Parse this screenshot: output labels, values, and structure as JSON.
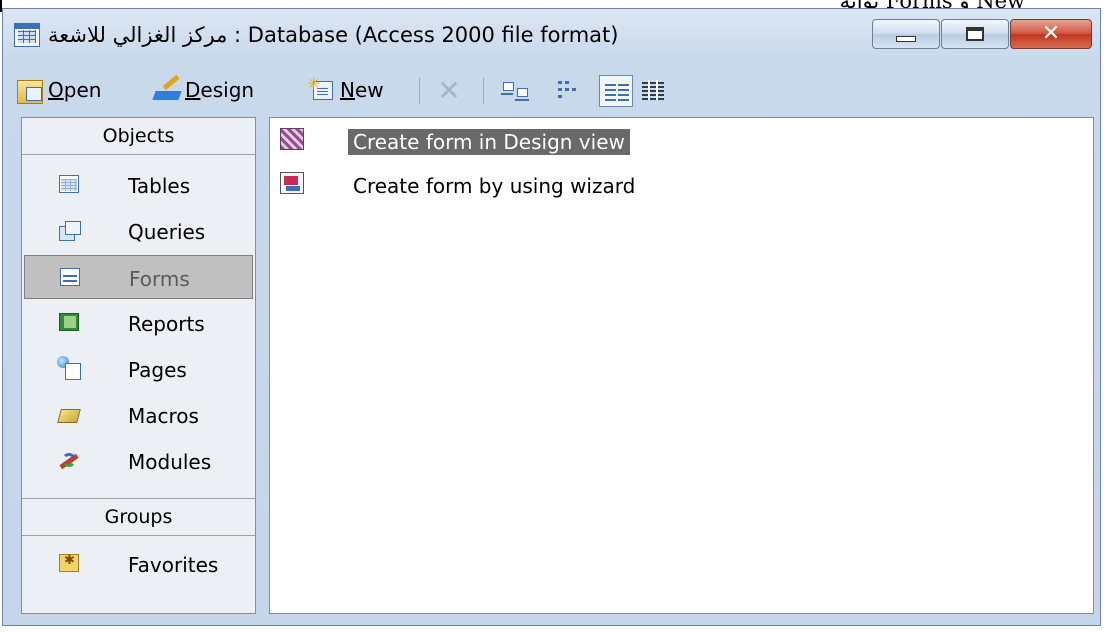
{
  "page_snippet": "بوابة Forms و New",
  "window": {
    "title": "مركز الغزالي للاشعة : Database (Access 2000 file format)",
    "controls": {
      "minimize": "minimize",
      "maximize": "maximize",
      "close": "✕"
    }
  },
  "toolbar": {
    "open": {
      "hotkey": "O",
      "rest": "pen"
    },
    "design": {
      "hotkey": "D",
      "rest": "esign"
    },
    "new": {
      "hotkey": "N",
      "rest": "ew"
    },
    "delete": "✕"
  },
  "objects_bar": {
    "objects_header": "Objects",
    "items": [
      {
        "label": "Tables",
        "icon": "table-icon"
      },
      {
        "label": "Queries",
        "icon": "query-icon"
      },
      {
        "label": "Forms",
        "icon": "form-icon",
        "selected": true
      },
      {
        "label": "Reports",
        "icon": "report-icon"
      },
      {
        "label": "Pages",
        "icon": "page-icon"
      },
      {
        "label": "Macros",
        "icon": "macro-icon"
      },
      {
        "label": "Modules",
        "icon": "module-icon"
      }
    ],
    "groups_header": "Groups",
    "groups": [
      {
        "label": "Favorites",
        "icon": "favorites-icon"
      }
    ]
  },
  "main_list": {
    "items": [
      {
        "label": "Create form in Design view",
        "icon": "design-view-icon",
        "selected": true
      },
      {
        "label": "Create form by using wizard",
        "icon": "wizard-icon",
        "selected": false
      }
    ]
  },
  "colors": {
    "title_gradient_top": "#dbe6f3",
    "close_button": "#c0361f",
    "selected_object": "#c0c0c0",
    "selected_list_item": "#696969"
  }
}
